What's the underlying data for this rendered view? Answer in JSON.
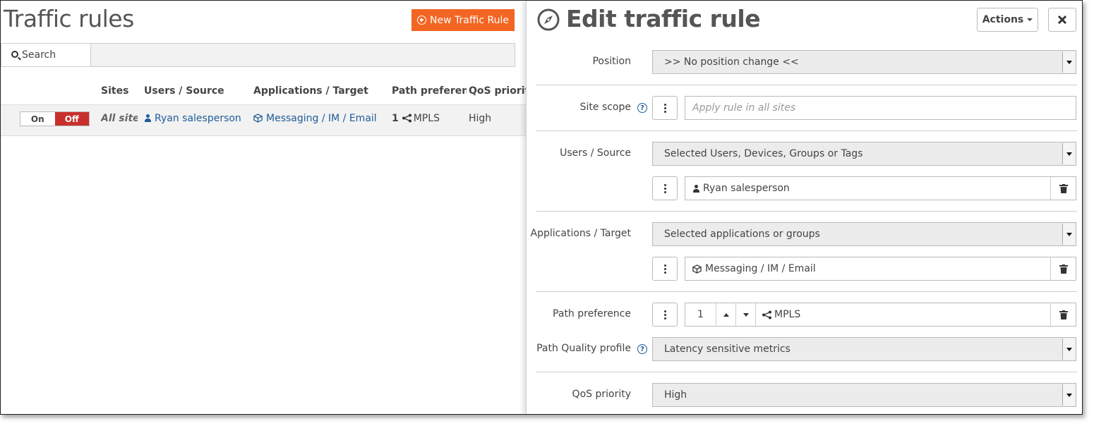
{
  "list": {
    "title": "Traffic rules",
    "new_rule_label": "New Traffic Rule",
    "search_label": "Search",
    "search_value": "",
    "columns": [
      "Sites",
      "Users / Source",
      "Applications / Target",
      "Path preference",
      "QoS priority"
    ],
    "rows": [
      {
        "toggle_on": "On",
        "toggle_off": "Off",
        "toggle_state": "Off",
        "sites": "All sites",
        "users": "Ryan salesperson",
        "applications": "Messaging / IM / Email",
        "path_rank": "1",
        "path_name": "MPLS",
        "qos": "High"
      }
    ]
  },
  "editor": {
    "title": "Edit traffic rule",
    "actions_label": "Actions",
    "position": {
      "label": "Position",
      "value": ">> No position change <<"
    },
    "site_scope": {
      "label": "Site scope",
      "help": "?",
      "placeholder": "Apply rule in all sites"
    },
    "users_source": {
      "label": "Users / Source",
      "select_value": "Selected Users, Devices, Groups or Tags",
      "item": "Ryan salesperson"
    },
    "applications_target": {
      "label": "Applications / Target",
      "select_value": "Selected applications or groups",
      "item": "Messaging / IM / Email"
    },
    "path_preference": {
      "label": "Path preference",
      "rank": "1",
      "path": "MPLS"
    },
    "path_quality": {
      "label": "Path Quality profile",
      "help": "?",
      "value": "Latency sensitive metrics"
    },
    "qos": {
      "label": "QoS priority",
      "value": "High"
    }
  },
  "colors": {
    "accent": "#f26522",
    "off_toggle": "#c9302c",
    "link": "#1f5c99"
  },
  "icons": [
    "plus-circle-icon",
    "search-icon",
    "person-icon",
    "cube-icon",
    "share-icon",
    "compass-icon",
    "close-icon",
    "kebab-icon",
    "trash-icon",
    "help-icon",
    "caret-down-icon"
  ]
}
